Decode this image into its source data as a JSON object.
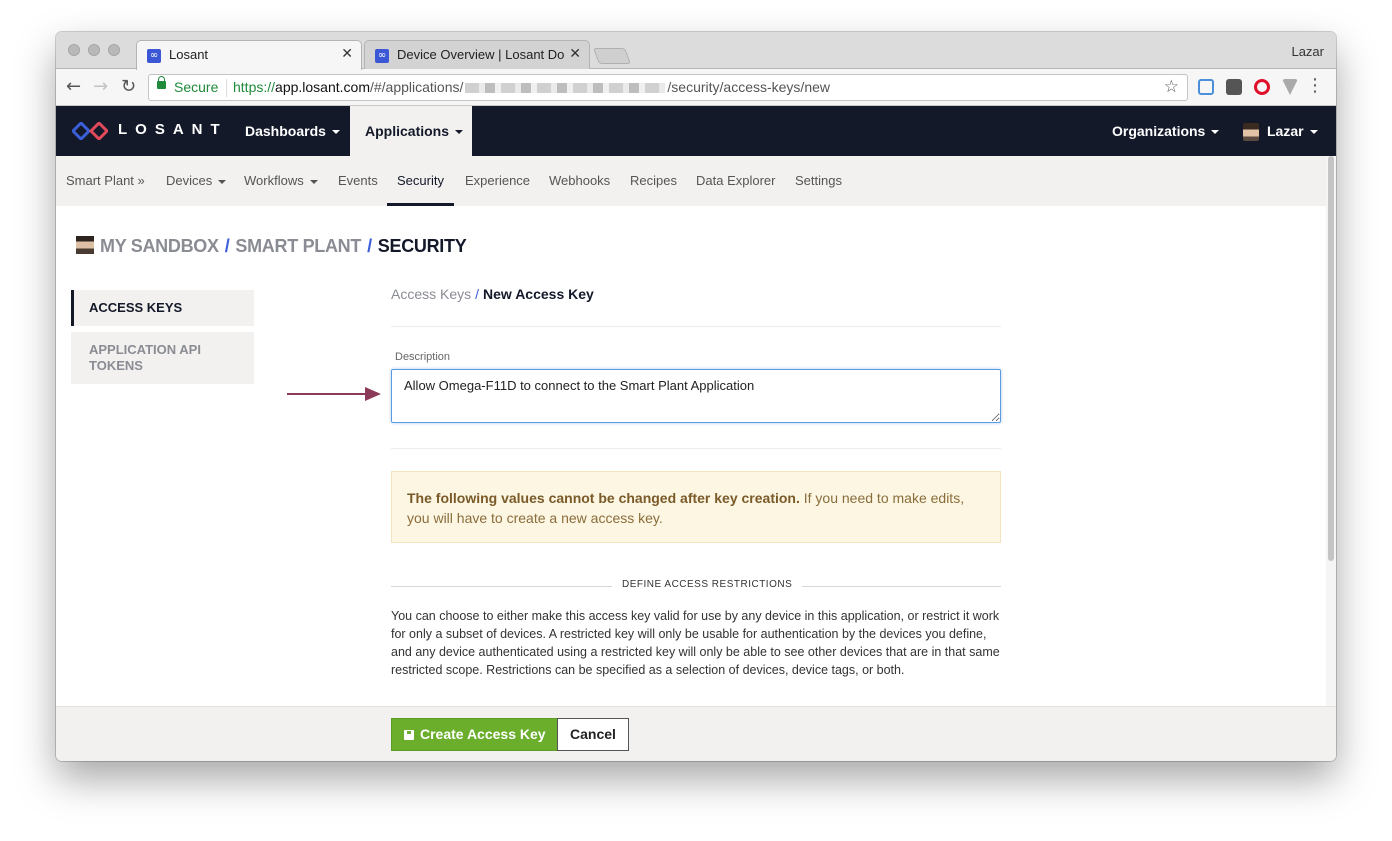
{
  "browser": {
    "tabs": [
      {
        "title": "Losant",
        "favicon": "losant-icon"
      },
      {
        "title": "Device Overview | Losant Docu",
        "favicon": "losant-icon"
      }
    ],
    "profile_name": "Lazar",
    "address": {
      "secure_label": "Secure",
      "url_protocol": "https://",
      "url_host": "app.losant.com",
      "url_path_start": "/#/applications/",
      "url_path_end": "/security/access-keys/new"
    }
  },
  "app": {
    "logo_text": "LOSANT",
    "topnav": {
      "dashboards": "Dashboards",
      "applications": "Applications",
      "organizations": "Organizations",
      "user": "Lazar"
    },
    "subnav": [
      {
        "label": "Smart Plant »"
      },
      {
        "label": "Devices"
      },
      {
        "label": "Workflows"
      },
      {
        "label": "Events"
      },
      {
        "label": "Security"
      },
      {
        "label": "Experience"
      },
      {
        "label": "Webhooks"
      },
      {
        "label": "Recipes"
      },
      {
        "label": "Data Explorer"
      },
      {
        "label": "Settings"
      }
    ],
    "breadcrumb": {
      "sandbox": "MY SANDBOX",
      "app": "SMART PLANT",
      "current": "SECURITY",
      "separator": "/"
    },
    "sidenav": [
      {
        "label": "ACCESS KEYS"
      },
      {
        "label": "APPLICATION API TOKENS"
      }
    ],
    "form": {
      "crumb_link": "Access Keys",
      "crumb_sep": "/",
      "crumb_current": "New Access Key",
      "description_label": "Description",
      "description_value": "Allow Omega-F11D to connect to the Smart Plant Application",
      "alert_bold": "The following values cannot be changed after key creation.",
      "alert_rest": " If you need to make edits, you will have to create a new access key.",
      "section_title": "DEFINE ACCESS RESTRICTIONS",
      "section_text": "You can choose to either make this access key valid for use by any device in this application, or restrict it work for only a subset of devices. A restricted key will only be usable for authentication by the devices you define, and any device authenticated using a restricted key will only be able to see other devices that are in that same restricted scope. Restrictions can be specified as a selection of devices, device tags, or both."
    },
    "footer": {
      "create_label": "Create Access Key",
      "cancel_label": "Cancel"
    }
  },
  "colors": {
    "navy": "#14192a",
    "accent_blue": "#3a5fd9",
    "create_green": "#6aae2c",
    "annotation_arrow": "#8b3a5a"
  }
}
